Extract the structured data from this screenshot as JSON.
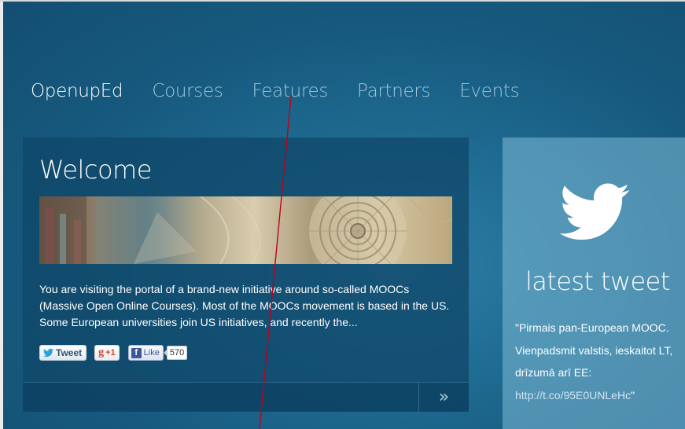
{
  "nav": {
    "brand": "OpenupEd",
    "items": [
      "Courses",
      "Features",
      "Partners",
      "Events"
    ]
  },
  "welcome": {
    "title": "Welcome",
    "intro": "You are visiting the portal of a brand-new initiative around so-called MOOCs (Massive Open Online Courses). Most of the MOOCs movement is based in the US. Some European universities join US initiatives, and recently the...",
    "banner_icon": "nautilus-shell-banner",
    "more_icon": "double-chevron-right-icon"
  },
  "social": {
    "tweet_label": "Tweet",
    "gplus_label": "+1",
    "like_label": "Like",
    "like_count": "570"
  },
  "tweet_panel": {
    "icon": "twitter-bird-icon",
    "heading": "latest tweet",
    "text": "\"Pirmais pan-European MOOC. Vienpadsmit valstis, ieskaitot LT, drīzumā arī EE: ",
    "link": "http://t.co/95E0UNLeHc",
    "close_quote": "\""
  },
  "colors": {
    "background": "#1b6189",
    "nav_inactive": "#9fc6da",
    "panel": "#7ebad6",
    "annotation_line": "#c0001a"
  }
}
